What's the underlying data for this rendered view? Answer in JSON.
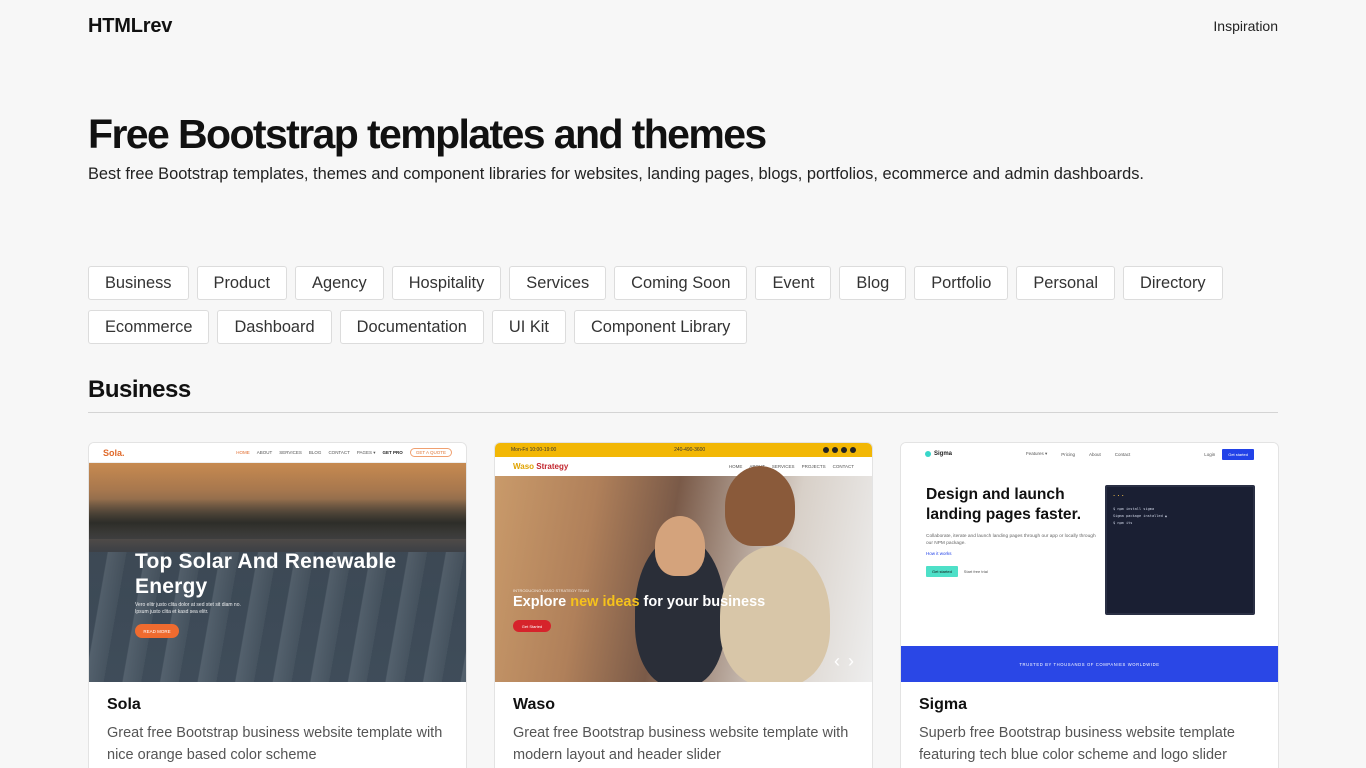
{
  "site": {
    "logo": "HTMLrev",
    "nav_link": "Inspiration"
  },
  "hero": {
    "title": "Free Bootstrap templates and themes",
    "subtitle": "Best free Bootstrap templates, themes and component libraries for websites, landing pages, blogs, portfolios, ecommerce and admin dashboards."
  },
  "tags": [
    "Business",
    "Product",
    "Agency",
    "Hospitality",
    "Services",
    "Coming Soon",
    "Event",
    "Blog",
    "Portfolio",
    "Personal",
    "Directory",
    "Ecommerce",
    "Dashboard",
    "Documentation",
    "UI Kit",
    "Component Library"
  ],
  "section": {
    "title": "Business"
  },
  "cards": [
    {
      "title": "Sola",
      "description": "Great free Bootstrap business website template with nice orange based color scheme",
      "thumb": {
        "logo": "Sola.",
        "nav": [
          "HOME",
          "ABOUT",
          "SERVICES",
          "BLOG",
          "CONTACT",
          "PAGES ▾",
          "GET PRO"
        ],
        "nav_button": "GET A QUOTE",
        "headline": "Top Solar And Renewable Energy",
        "sub": "Vero elitr justo clita dolor at sed stet sit diam no. Ipsum justo clita et kasd sea elitr.",
        "cta": "READ MORE"
      }
    },
    {
      "title": "Waso",
      "description": "Great free Bootstrap business website template with modern layout and header slider",
      "thumb": {
        "topbar_left": "Mon-Fri 10:00-19:00",
        "topbar_mid": "240-490-3600",
        "logo_a": "Waso ",
        "logo_b": "Strategy",
        "nav": [
          "HOME",
          "ABOUT",
          "SERVICES",
          "PROJECTS",
          "CONTACT"
        ],
        "kicker": "INTRODUCING WASO STRATEGY TEAM",
        "headline_a": "Explore ",
        "headline_accent": "new ideas",
        "headline_b": " for your business",
        "cta": "Get Started"
      }
    },
    {
      "title": "Sigma",
      "description": "Superb free Bootstrap business website template featuring tech blue color scheme and logo slider",
      "thumb": {
        "logo": "Sigma",
        "nav": [
          "Features ▾",
          "Pricing",
          "About",
          "Contact"
        ],
        "login": "Login",
        "nav_button": "Get started",
        "headline": "Design and launch landing pages faster.",
        "sub": "Collaborate, iterate and launch landing pages through our app or locally through our NPM package.",
        "link": "How it works",
        "cta": "Get started",
        "cta2": "Start free trial",
        "terminal": [
          "$ npm install sigma",
          "Sigma package installed ▲",
          "",
          "$ npm its"
        ],
        "band": "TRUSTED BY THOUSANDS OF COMPANIES WORLDWIDE"
      }
    }
  ]
}
